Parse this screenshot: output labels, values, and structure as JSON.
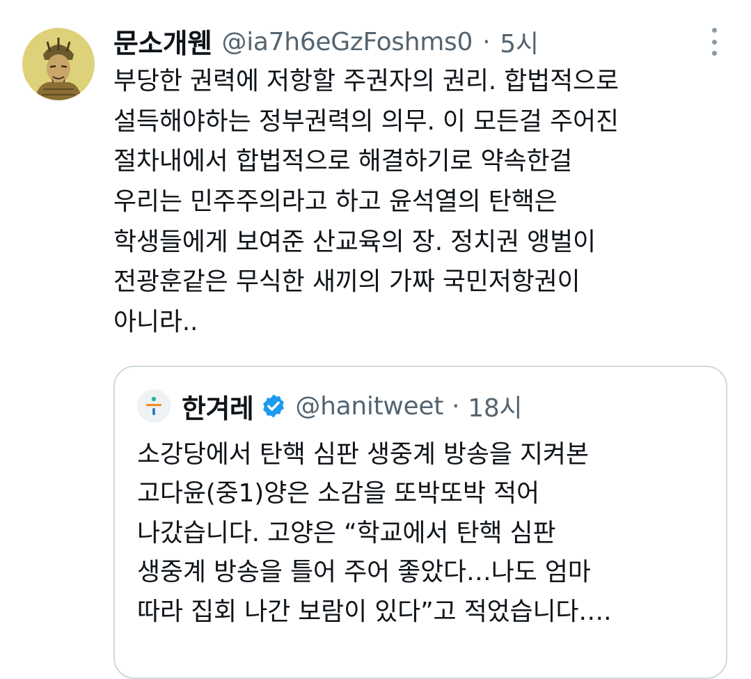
{
  "tweet": {
    "author_name": "문소개웬",
    "handle": "@ia7h6eGzFoshms0",
    "separator": "·",
    "time": "5시",
    "lines": [
      "부당한 권력에 저항할 주권자의 권리. 합법적으로",
      "설득해야하는 정부권력의 의무. 이 모든걸 주어진",
      "절차내에서 합법적으로 해결하기로 약속한걸",
      "우리는 민주주의라고 하고 윤석열의 탄핵은",
      "학생들에게 보여준 산교육의 장.  정치권 앵벌이",
      "전광훈같은 무식한 새끼의 가짜 국민저항권이",
      "아니라.."
    ]
  },
  "quote": {
    "author_name": "한겨레",
    "handle": "@hanitweet",
    "separator": "·",
    "time": "18시",
    "lines": [
      "소강당에서 탄핵 심판 생중계 방송을 지켜본",
      "고다윤(중1)양은 소감을 또박또박 적어",
      "나갔습니다. 고양은 “학교에서 탄핵 심판",
      "생중계 방송을 틀어 주어 좋았다…나도 엄마",
      "따라 집회 나간 보람이 있다”고 적었습니다…."
    ]
  },
  "icons": {
    "avatar": "portrait-illustration",
    "more": "more-options-icon",
    "quote_avatar": "hankyoreh-logo",
    "verified": "verified-badge-icon"
  },
  "colors": {
    "text": "#0f1419",
    "secondary": "#536471",
    "border": "#cfd9de",
    "verified": "#1d9bf0",
    "avatar_bg": "#d9cd70"
  }
}
